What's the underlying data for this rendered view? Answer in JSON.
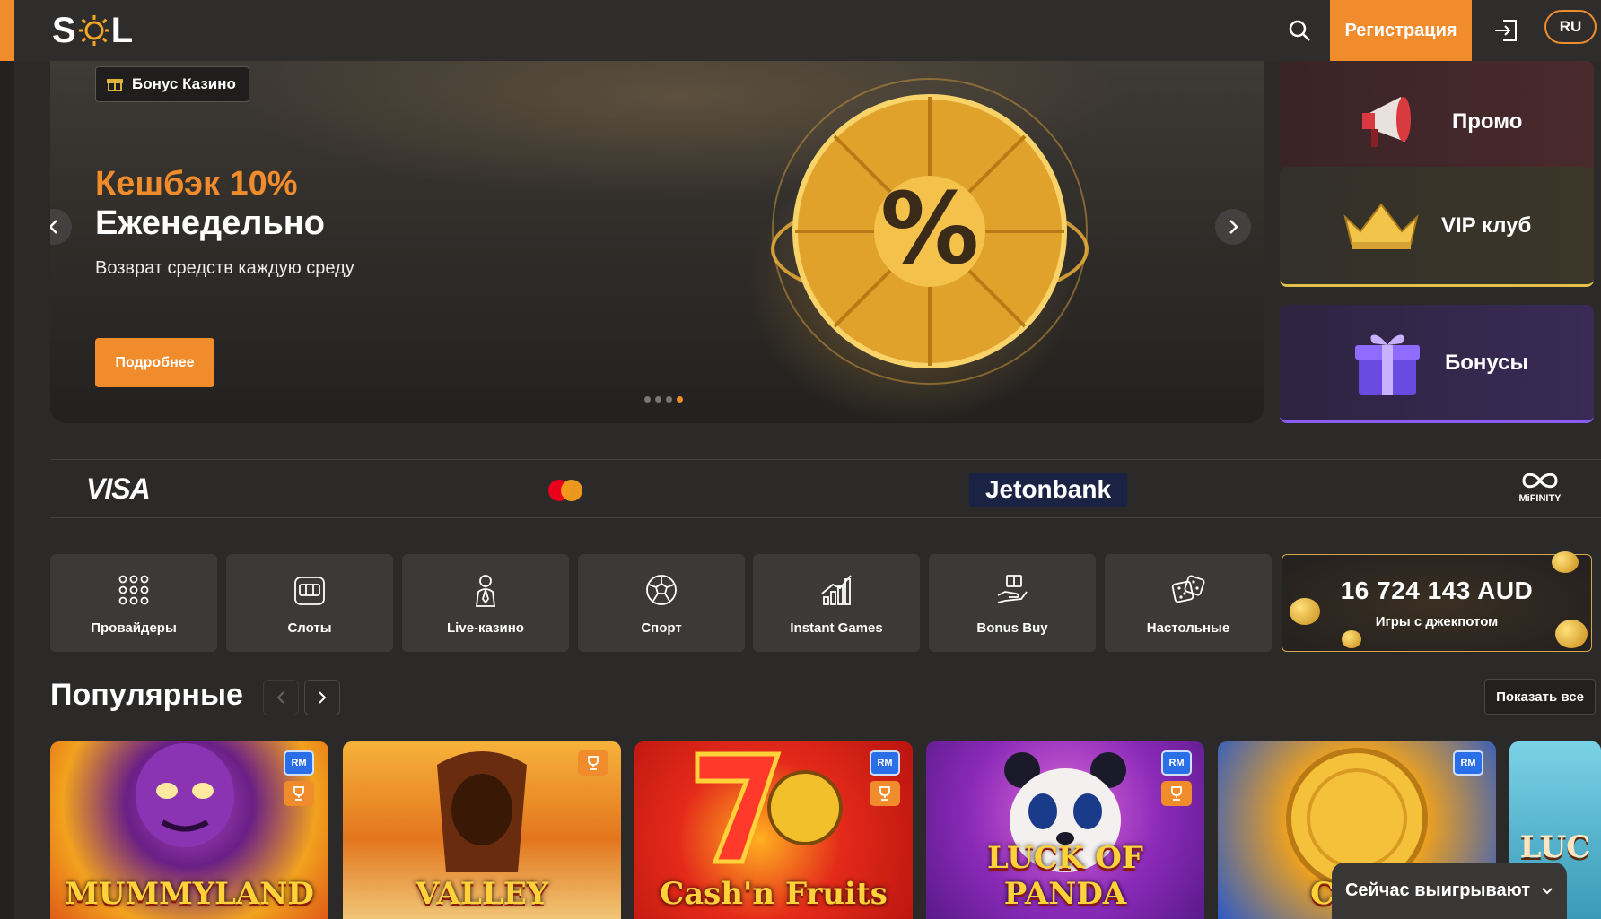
{
  "header": {
    "logo_text": "SOL",
    "register_label": "Регистрация",
    "lang_label": "RU"
  },
  "hero": {
    "tag_label": "Бонус Казино",
    "title_accent": "Кешбэк 10%",
    "title": "Еженедельно",
    "subtitle": "Возврат средств каждую среду",
    "more_label": "Подробнее",
    "slides_total": 4,
    "active_slide": 4
  },
  "promos": [
    {
      "label": "Промо",
      "icon": "megaphone-icon"
    },
    {
      "label": "VIP клуб",
      "icon": "crown-icon"
    },
    {
      "label": "Бонусы",
      "icon": "gift-icon"
    }
  ],
  "payments": {
    "visa": "VISA",
    "jeton": "Jetonbank",
    "mifinity": "MiFINITY"
  },
  "categories": [
    {
      "label": "Провайдеры",
      "icon": "grid-dots-icon"
    },
    {
      "label": "Слоты",
      "icon": "slot-machine-icon"
    },
    {
      "label": "Live-казино",
      "icon": "dealer-icon"
    },
    {
      "label": "Спорт",
      "icon": "football-icon"
    },
    {
      "label": "Instant Games",
      "icon": "chart-bars-icon"
    },
    {
      "label": "Bonus Buy",
      "icon": "hand-gift-icon"
    },
    {
      "label": "Настольные",
      "icon": "dice-icon"
    }
  ],
  "jackpot": {
    "amount": "16 724 143 AUD",
    "label": "Игры с джекпотом"
  },
  "popular": {
    "title": "Популярные",
    "show_all_label": "Показать все"
  },
  "games": [
    {
      "title": "MUMMYLAND",
      "badges": [
        "RM",
        "cup"
      ]
    },
    {
      "title": "VALLEY",
      "badges": [
        "cup"
      ]
    },
    {
      "title": "Cash'n Fruits",
      "badges": [
        "RM",
        "cup"
      ]
    },
    {
      "title": "LUCK OF PANDA",
      "badges": [
        "RM",
        "cup"
      ]
    },
    {
      "title": "COIN",
      "badges": [
        "RM"
      ]
    },
    {
      "title": "LUC",
      "badges": []
    }
  ],
  "winning_now": {
    "label": "Сейчас выигрывают"
  },
  "colors": {
    "accent": "#f08c2c",
    "background": "#2b2a29",
    "card": "#3c3a38"
  }
}
